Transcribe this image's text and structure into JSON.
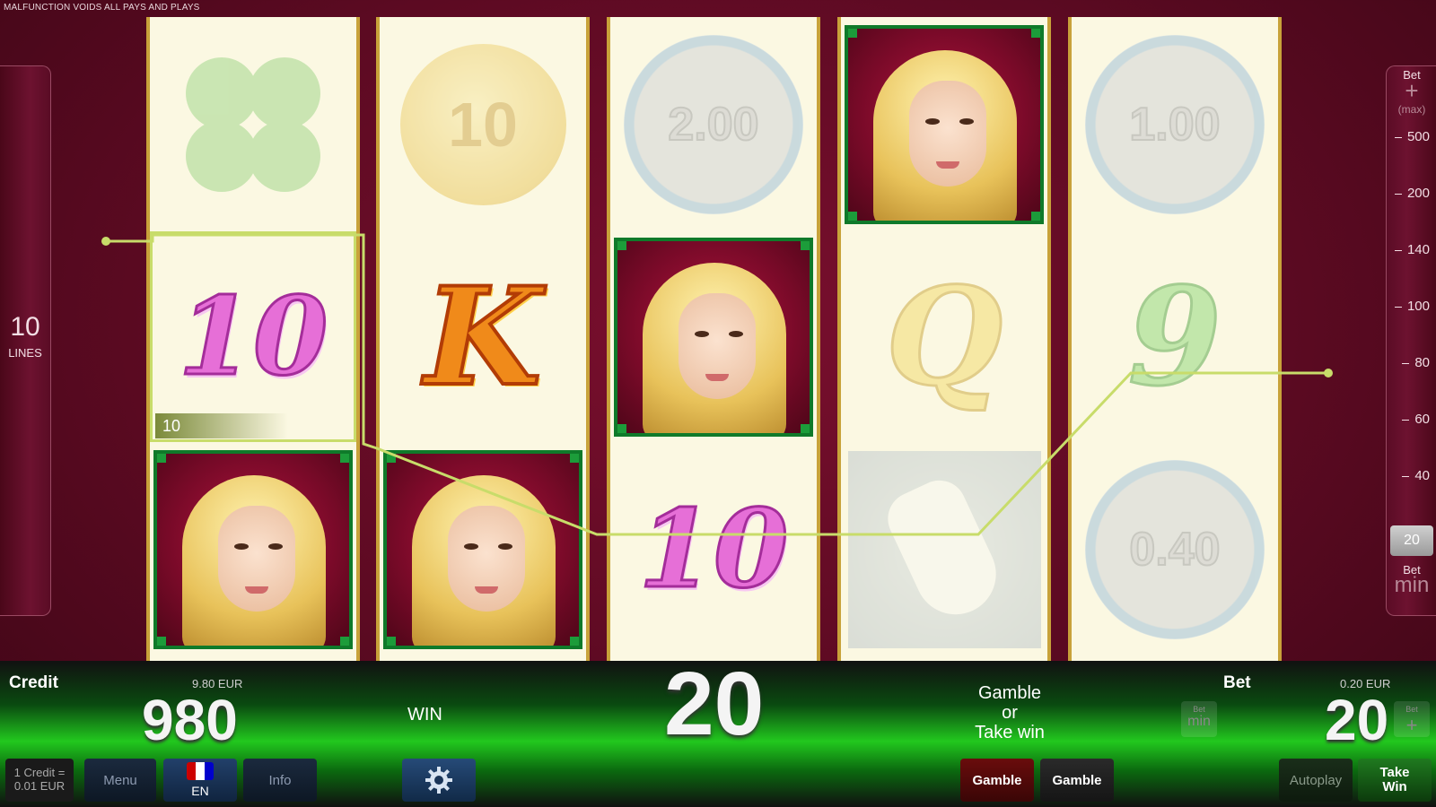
{
  "disclaimer": "MALFUNCTION VOIDS ALL PAYS AND PLAYS",
  "lines": {
    "count": "10",
    "label": "LINES"
  },
  "bet_scale": {
    "top_label": "Bet",
    "plus": "+",
    "max_label": "(max)",
    "ticks": [
      "500",
      "200",
      "140",
      "100",
      "80",
      "60",
      "40"
    ],
    "current": "20",
    "min_label_top": "Bet",
    "min_label": "min"
  },
  "reels": [
    [
      {
        "type": "clover",
        "dim": true
      },
      {
        "type": "ten",
        "text": "10",
        "highlight": true,
        "badge": "10"
      },
      {
        "type": "lady"
      }
    ],
    [
      {
        "type": "goldcoin",
        "text": "10",
        "dim": true
      },
      {
        "type": "k",
        "text": "K"
      },
      {
        "type": "lady"
      }
    ],
    [
      {
        "type": "coin",
        "text": "2.00",
        "dim": true
      },
      {
        "type": "lady"
      },
      {
        "type": "ten",
        "text": "10"
      }
    ],
    [
      {
        "type": "lady"
      },
      {
        "type": "q",
        "text": "Q",
        "dim": true
      },
      {
        "type": "charm",
        "dim": true
      }
    ],
    [
      {
        "type": "coin",
        "text": "1.00",
        "dim": true
      },
      {
        "type": "nine",
        "text": "9",
        "dim": true
      },
      {
        "type": "coin",
        "text": "0.40",
        "dim": true
      }
    ]
  ],
  "bottom": {
    "credit_label": "Credit",
    "credit_eur": "9.80 EUR",
    "credit_value": "980",
    "win_label": "WIN",
    "win_value": "20",
    "gamble_prompt": [
      "Gamble",
      "or",
      "Take win"
    ],
    "bet_label": "Bet",
    "bet_eur": "0.20 EUR",
    "bet_value": "20",
    "bet_min_small": "Bet",
    "bet_min": "min",
    "bet_plus_small": "Bet",
    "bet_plus": "+"
  },
  "buttons": {
    "credit_info": [
      "1 Credit =",
      "0.01 EUR"
    ],
    "menu": "Menu",
    "language": "EN",
    "info": "Info",
    "settings_icon": "gear-icon",
    "gamble_red": "Gamble",
    "gamble_black": "Gamble",
    "autoplay": "Autoplay",
    "take_win": [
      "Take",
      "Win"
    ]
  }
}
